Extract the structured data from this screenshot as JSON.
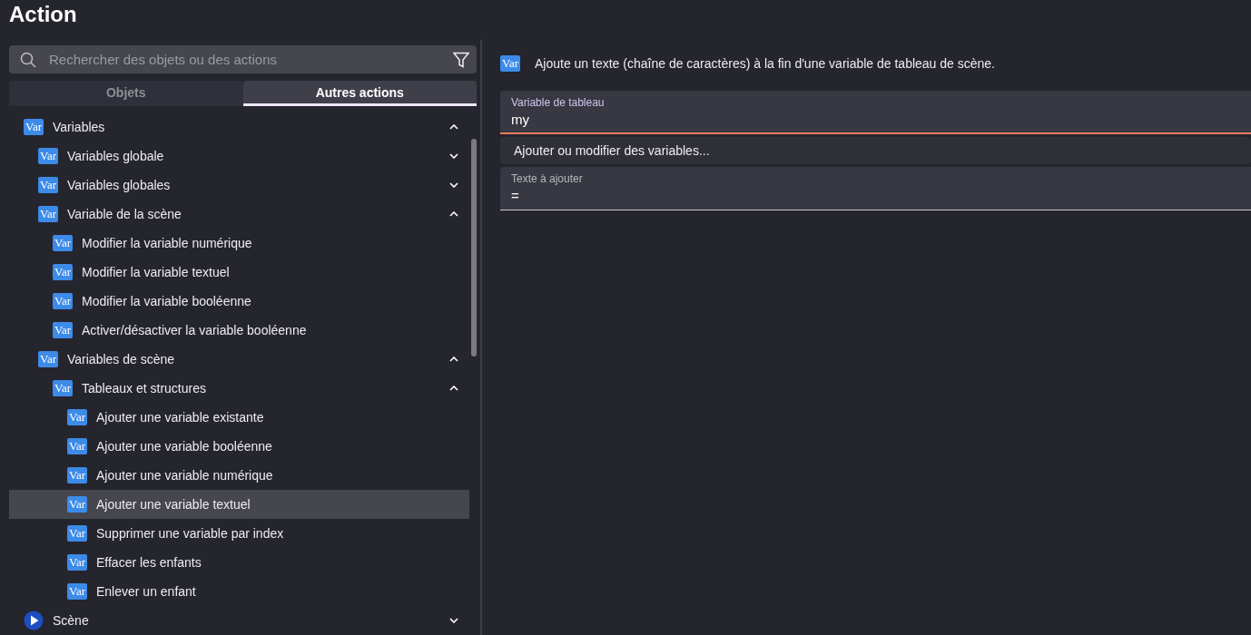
{
  "title": "Action",
  "search": {
    "placeholder": "Rechercher des objets ou des actions"
  },
  "tabs": [
    {
      "label": "Objets",
      "selected": false
    },
    {
      "label": "Autres actions",
      "selected": true
    }
  ],
  "tree": [
    {
      "label": "Variables",
      "kind": "tag",
      "icon_label": "Var",
      "expanded": true,
      "selected": false,
      "children": [
        {
          "label": "Variables globale",
          "kind": "tag",
          "icon_label": "Var",
          "expanded": false,
          "selected": false
        },
        {
          "label": "Variables globales",
          "kind": "tag",
          "icon_label": "Var",
          "expanded": false,
          "selected": false
        },
        {
          "label": "Variable de la scène",
          "kind": "tag",
          "icon_label": "Var",
          "expanded": true,
          "selected": false,
          "children": [
            {
              "label": "Modifier la variable numérique",
              "kind": "tag",
              "icon_label": "Var",
              "selected": false
            },
            {
              "label": "Modifier la variable textuel",
              "kind": "tag",
              "icon_label": "Var",
              "selected": false
            },
            {
              "label": "Modifier la variable booléenne",
              "kind": "tag",
              "icon_label": "Var",
              "selected": false
            },
            {
              "label": "Activer/désactiver la variable booléenne",
              "kind": "tag",
              "icon_label": "Var",
              "selected": false
            }
          ]
        },
        {
          "label": "Variables de scène",
          "kind": "tag",
          "icon_label": "Var",
          "expanded": true,
          "selected": false,
          "children": [
            {
              "label": "Tableaux et structures",
              "kind": "tag",
              "icon_label": "Var",
              "expanded": true,
              "selected": false,
              "children": [
                {
                  "label": "Ajouter une variable existante",
                  "kind": "tag",
                  "icon_label": "Var",
                  "selected": false
                },
                {
                  "label": "Ajouter une variable booléenne",
                  "kind": "tag",
                  "icon_label": "Var",
                  "selected": false
                },
                {
                  "label": "Ajouter une variable numérique",
                  "kind": "tag",
                  "icon_label": "Var",
                  "selected": false
                },
                {
                  "label": "Ajouter une variable textuel",
                  "kind": "tag",
                  "icon_label": "Var",
                  "selected": true
                },
                {
                  "label": "Supprimer une variable par index",
                  "kind": "tag",
                  "icon_label": "Var",
                  "selected": false
                },
                {
                  "label": "Effacer les enfants",
                  "kind": "tag",
                  "icon_label": "Var",
                  "selected": false
                },
                {
                  "label": "Enlever un enfant",
                  "kind": "tag",
                  "icon_label": "Var",
                  "selected": false
                }
              ]
            }
          ]
        }
      ]
    },
    {
      "label": "Scène",
      "kind": "play",
      "expanded": false,
      "selected": false
    }
  ],
  "description": {
    "icon_label": "Var",
    "text": "Ajoute un texte (chaîne de caractères) à la fin d'une variable de tableau de scène."
  },
  "fields": [
    {
      "kind": "field",
      "label": "Variable de tableau",
      "value": "my",
      "focused": true
    },
    {
      "kind": "button",
      "label": "Ajouter ou modifier des variables..."
    },
    {
      "kind": "field",
      "label": "Texte à ajouter",
      "value": "=",
      "focused": false
    }
  ]
}
